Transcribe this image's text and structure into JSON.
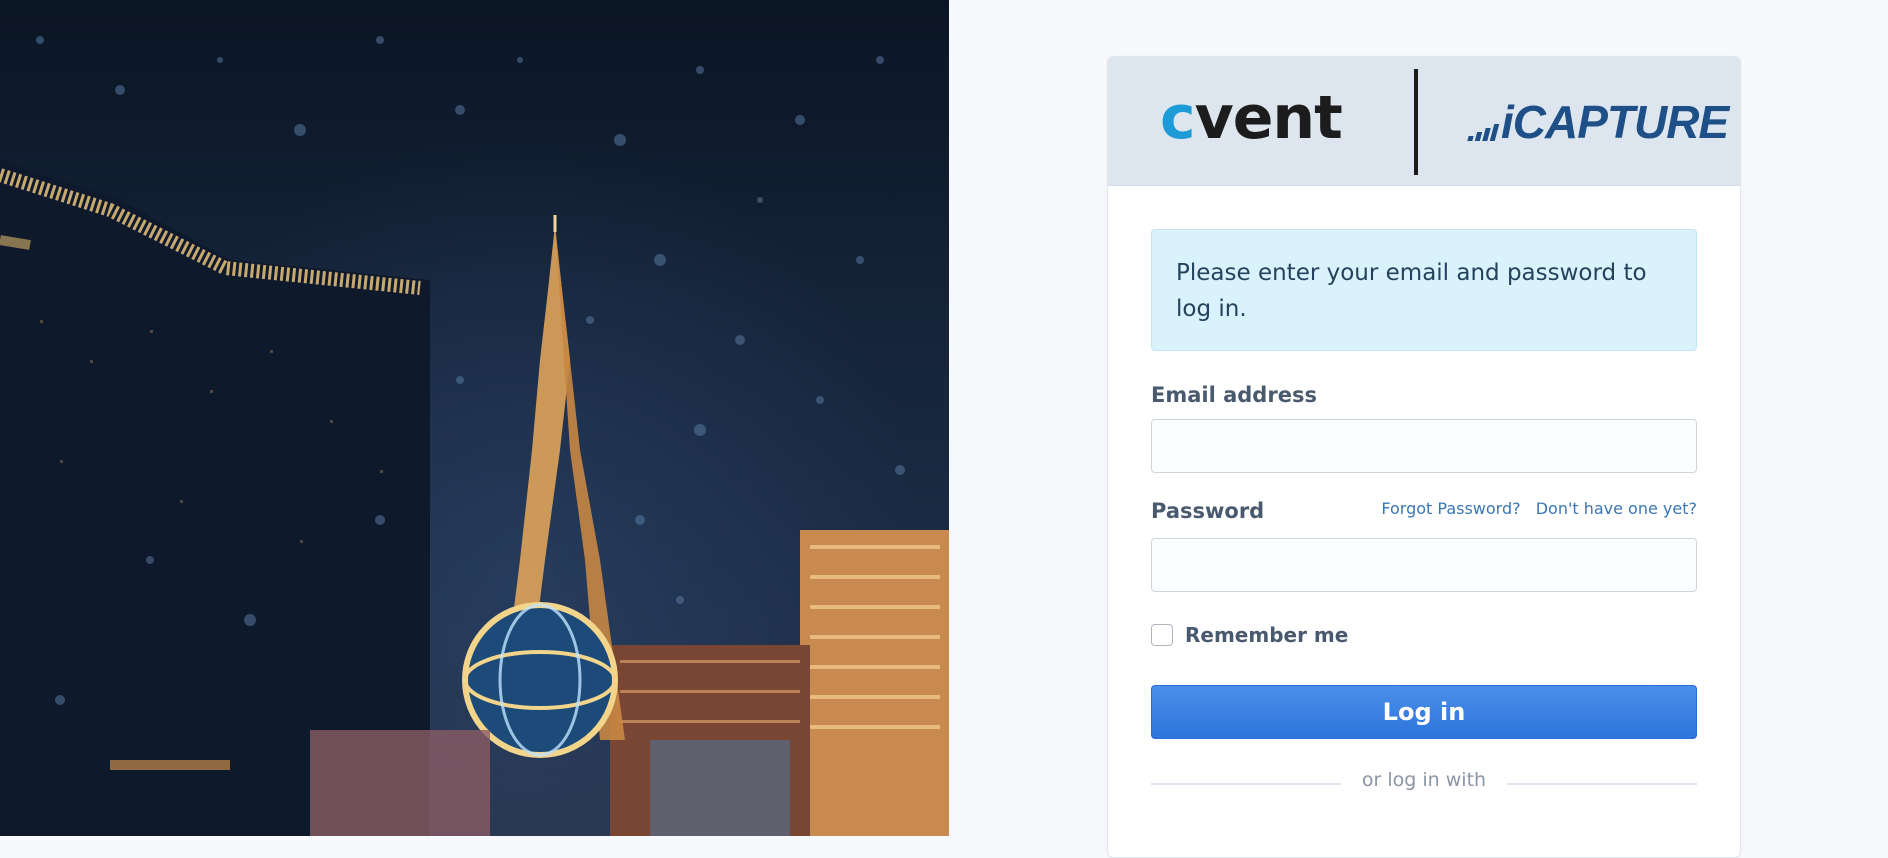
{
  "header": {
    "cvent_logo_text": "vent",
    "cvent_logo_c": "c",
    "icapture_logo_text": "iCAPTURE"
  },
  "alert": {
    "message": "Please enter your email and password to log in."
  },
  "form": {
    "email_label": "Email address",
    "email_value": "",
    "password_label": "Password",
    "password_value": "",
    "forgot_password": "Forgot Password?",
    "no_account": "Don't have one yet?",
    "remember_me": "Remember me",
    "remember_checked": false,
    "login_button": "Log in",
    "alt_login": "or log in with"
  },
  "colors": {
    "primary_button": "#2f74dc",
    "alert_bg": "#daf2fc",
    "link": "#3a76b5",
    "header_bg": "#dde5ef",
    "cvent_accent": "#1d9bd7",
    "icapture_blue": "#1e4f86"
  }
}
